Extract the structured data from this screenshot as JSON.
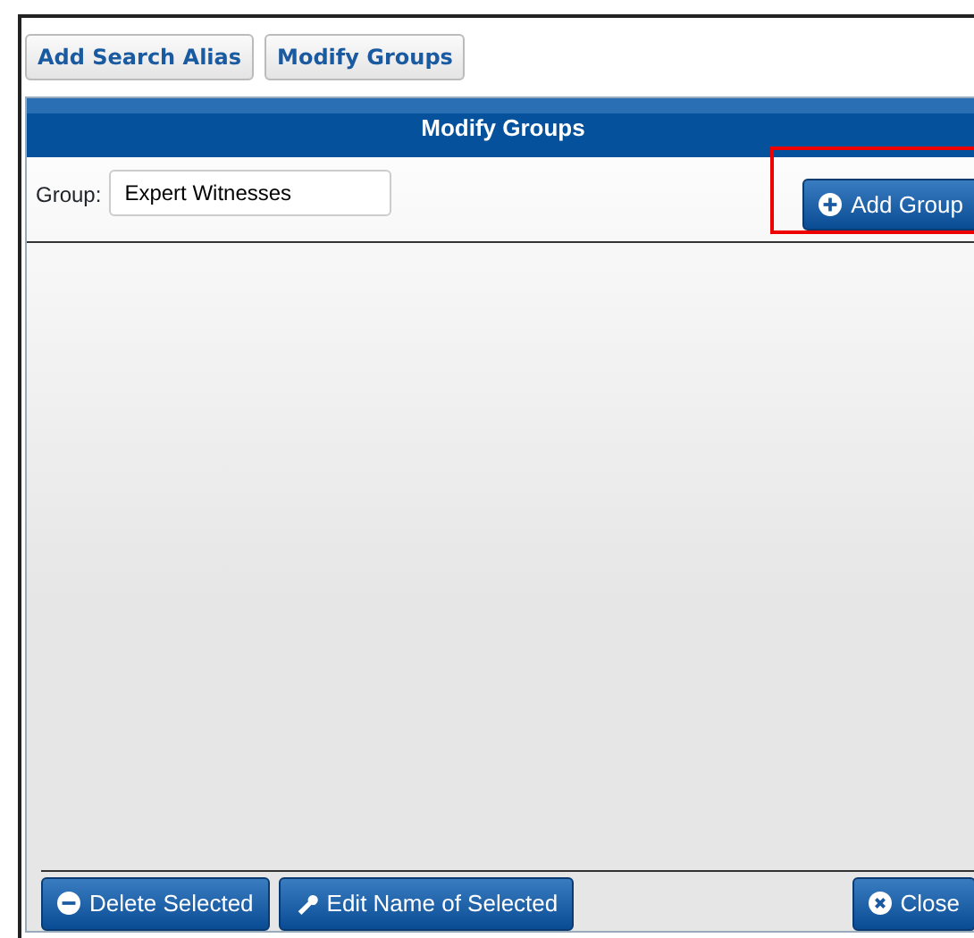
{
  "top_buttons": [
    {
      "label": "Add Search Alias"
    },
    {
      "label": "Modify Groups"
    }
  ],
  "panel": {
    "title": "Modify Groups",
    "group_label": "Group:",
    "group_value": "Expert Witnesses",
    "add_button": {
      "label": "Add Group",
      "highlighted": true
    },
    "footer_buttons": [
      {
        "label": "Delete Selected",
        "kind": "delete"
      },
      {
        "label": "Edit Name of Selected",
        "kind": "edit"
      }
    ],
    "close_button": {
      "label": "Close",
      "kind": "close"
    }
  }
}
